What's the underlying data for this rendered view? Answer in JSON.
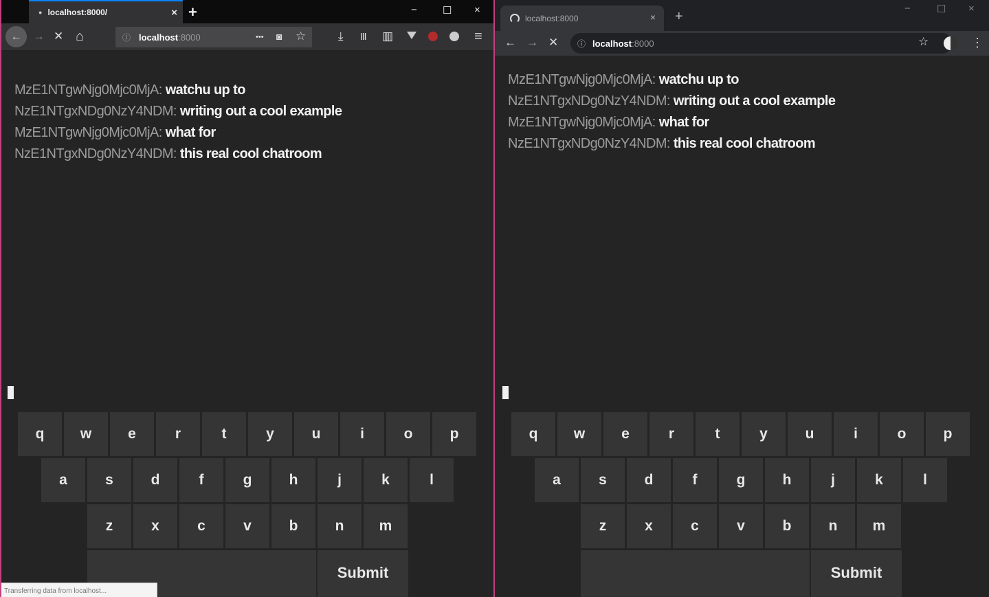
{
  "firefox": {
    "tab_title": "localhost:8000/",
    "url_host": "localhost",
    "url_port": ":8000",
    "status_text": "Transferring data from localhost..."
  },
  "chrome": {
    "tab_title": "localhost:8000",
    "url_host": "localhost",
    "url_port": ":8000"
  },
  "icons": {
    "close": "×",
    "newtab": "+",
    "minimize": "−",
    "maximize": "☐",
    "back": "←",
    "forward": "→",
    "stop": "✕",
    "home": "⌂",
    "info": "ⓘ",
    "more": "•••",
    "pocket": "◙",
    "star": "☆",
    "download": "⤓",
    "library": "Ⅲ",
    "sidebar": "▥",
    "menu": "≡",
    "kebab": "⋮"
  },
  "messages": [
    {
      "user": "MzE1NTgwNjg0Mjc0MjA",
      "text": "watchu up to"
    },
    {
      "user": "NzE1NTgxNDg0NzY4NDM",
      "text": "writing out a cool example"
    },
    {
      "user": "MzE1NTgwNjg0Mjc0MjA",
      "text": "what for"
    },
    {
      "user": "NzE1NTgxNDg0NzY4NDM",
      "text": "this real cool chatroom"
    }
  ],
  "keyboard": {
    "row1": [
      "q",
      "w",
      "e",
      "r",
      "t",
      "y",
      "u",
      "i",
      "o",
      "p"
    ],
    "row2": [
      "a",
      "s",
      "d",
      "f",
      "g",
      "h",
      "j",
      "k",
      "l"
    ],
    "row3": [
      "z",
      "x",
      "c",
      "v",
      "b",
      "n",
      "m"
    ],
    "submit_label": "Submit"
  }
}
